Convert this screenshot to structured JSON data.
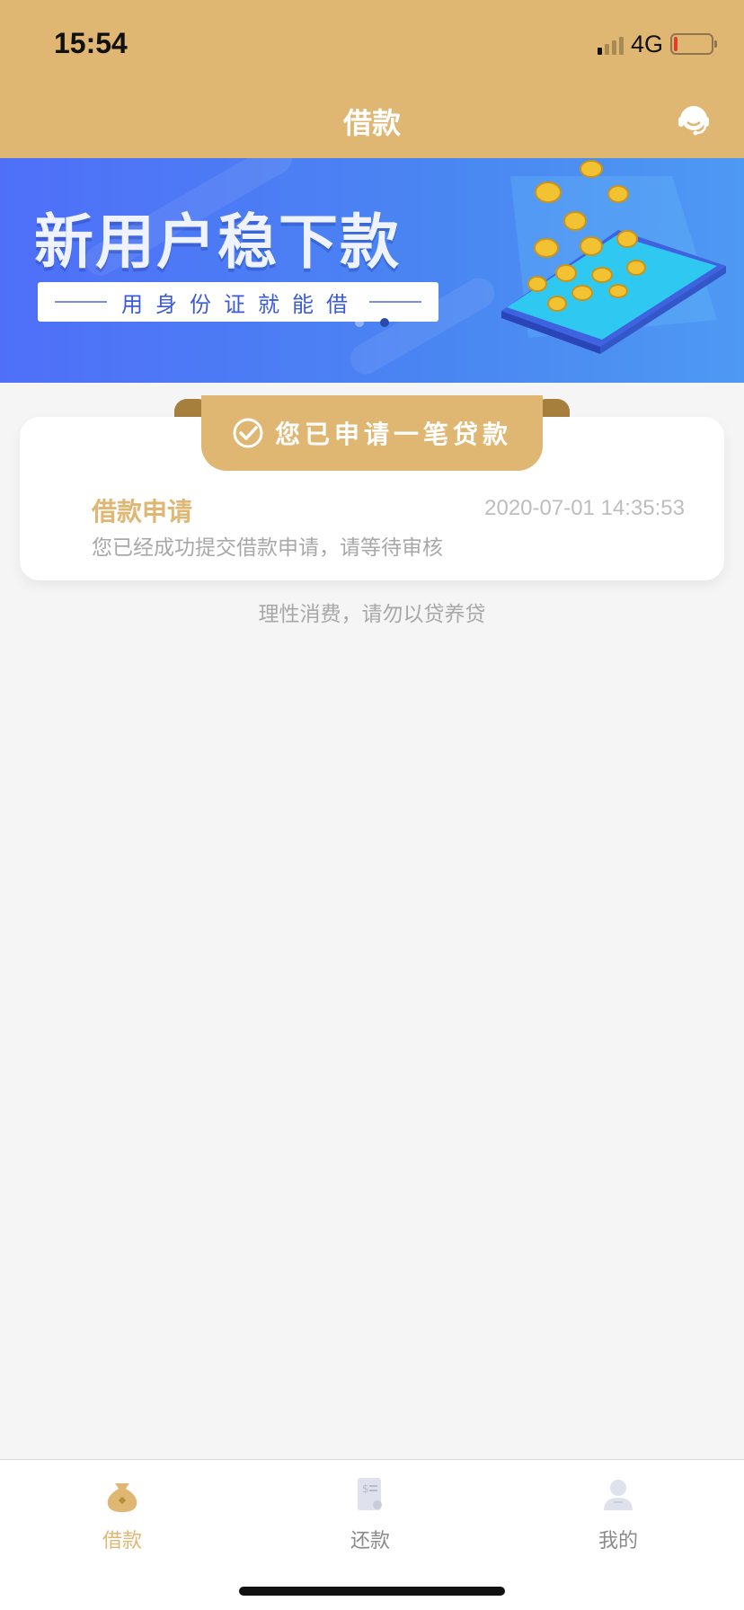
{
  "status_bar": {
    "time": "15:54",
    "network": "4G",
    "battery_level_percent": 10,
    "signal_bars_active": 1
  },
  "nav": {
    "title": "借款",
    "support_icon": "customer-service-headset-icon"
  },
  "banner": {
    "headline": "新用户稳下款",
    "subline": "用身份证就能借",
    "slide_count": 2,
    "active_slide": 2
  },
  "application_card": {
    "ribbon_text": "您已申请一笔贷款",
    "title": "借款申请",
    "timestamp": "2020-07-01 14:35:53",
    "description": "您已经成功提交借款申请，请等待审核"
  },
  "slogan": "理性消费，请勿以贷养贷",
  "tabbar": {
    "items": [
      {
        "label": "借款",
        "icon": "money-bag-icon",
        "active": true
      },
      {
        "label": "还款",
        "icon": "bill-icon",
        "active": false
      },
      {
        "label": "我的",
        "icon": "user-profile-icon",
        "active": false
      }
    ]
  },
  "colors": {
    "accent": "#dfb772",
    "banner_blue": "#4f6ff8",
    "muted_text": "#a8a8a8",
    "inactive_tab": "#8a8a8a"
  }
}
